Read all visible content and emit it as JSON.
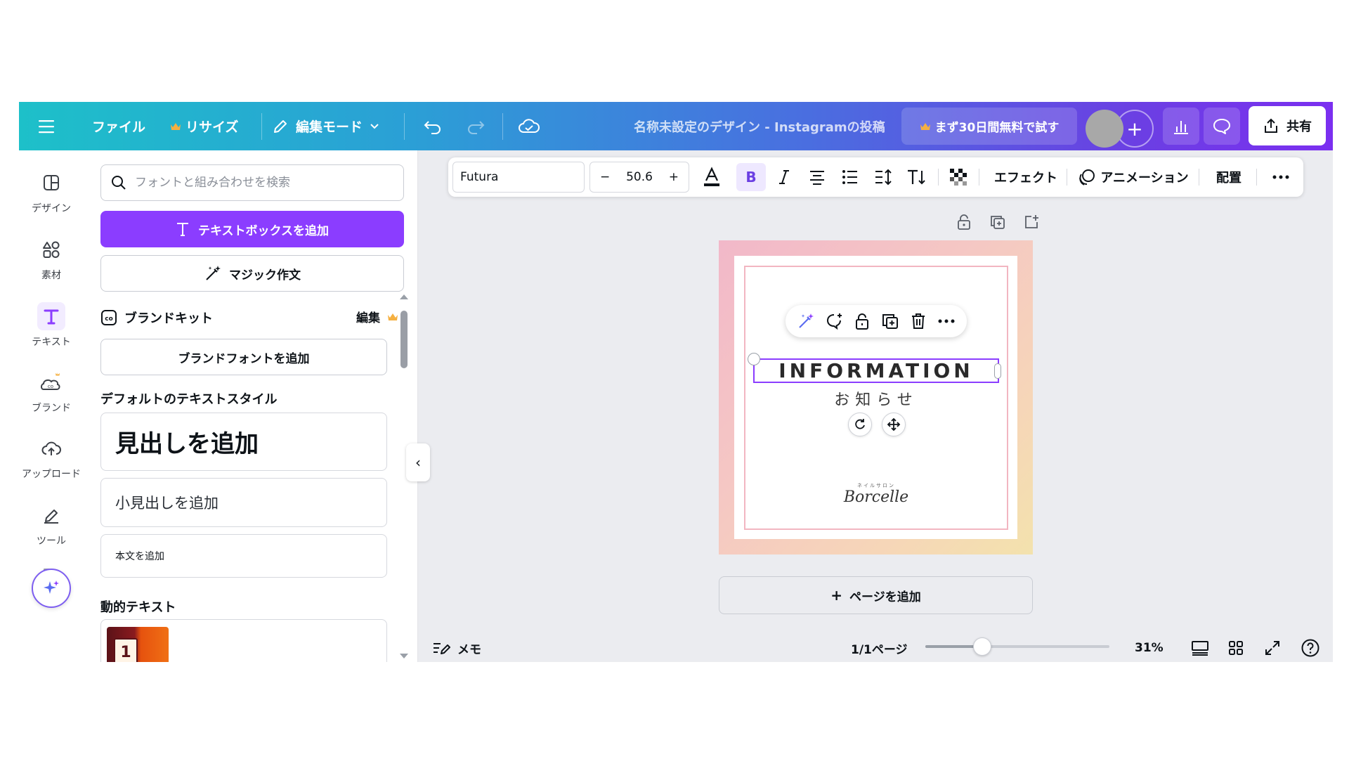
{
  "topbar": {
    "file_label": "ファイル",
    "resize_label": "リサイズ",
    "edit_mode_label": "編集モード",
    "doc_title": "名称未設定のデザイン - Instagramの投稿",
    "trial_label": "まず30日間無料で試す",
    "share_label": "共有"
  },
  "rail": {
    "items": [
      {
        "label": "デザイン",
        "icon": "layout-icon"
      },
      {
        "label": "素材",
        "icon": "shapes-icon"
      },
      {
        "label": "テキスト",
        "icon": "text-icon"
      },
      {
        "label": "ブランド",
        "icon": "brand-icon"
      },
      {
        "label": "アップロード",
        "icon": "cloud-upload-icon"
      },
      {
        "label": "ツール",
        "icon": "pen-tool-icon"
      }
    ]
  },
  "panel": {
    "search_placeholder": "フォントと組み合わせを検索",
    "add_textbox_label": "テキストボックスを追加",
    "magic_write_label": "マジック作文",
    "brand_kit_label": "ブランドキット",
    "brand_kit_edit": "編集",
    "add_brand_font_label": "ブランドフォントを追加",
    "default_styles_heading": "デフォルトのテキストスタイル",
    "heading_sample": "見出しを追加",
    "subheading_sample": "小見出しを追加",
    "body_sample": "本文を追加",
    "dynamic_text_heading": "動的テキスト",
    "dynamic_thumb_number": "1"
  },
  "texttools": {
    "font_name": "Futura",
    "font_size": "50.6",
    "minus": "−",
    "plus": "+",
    "effects_label": "エフェクト",
    "animation_label": "アニメーション",
    "position_label": "配置"
  },
  "canvas": {
    "headline": "INFORMATION",
    "subline": "お知らせ",
    "brand_small": "ネイルサロン",
    "brand_name": "Borcelle",
    "add_page_label": "ページを追加"
  },
  "footer": {
    "notes_label": "メモ",
    "page_indicator": "1/1ページ",
    "zoom": "31%",
    "zoom_fraction": 0.31
  },
  "colors": {
    "accent": "#8b3dff",
    "topbar_start": "#1dc0c9",
    "topbar_end": "#7b2ff0",
    "crown": "#f5b041"
  }
}
